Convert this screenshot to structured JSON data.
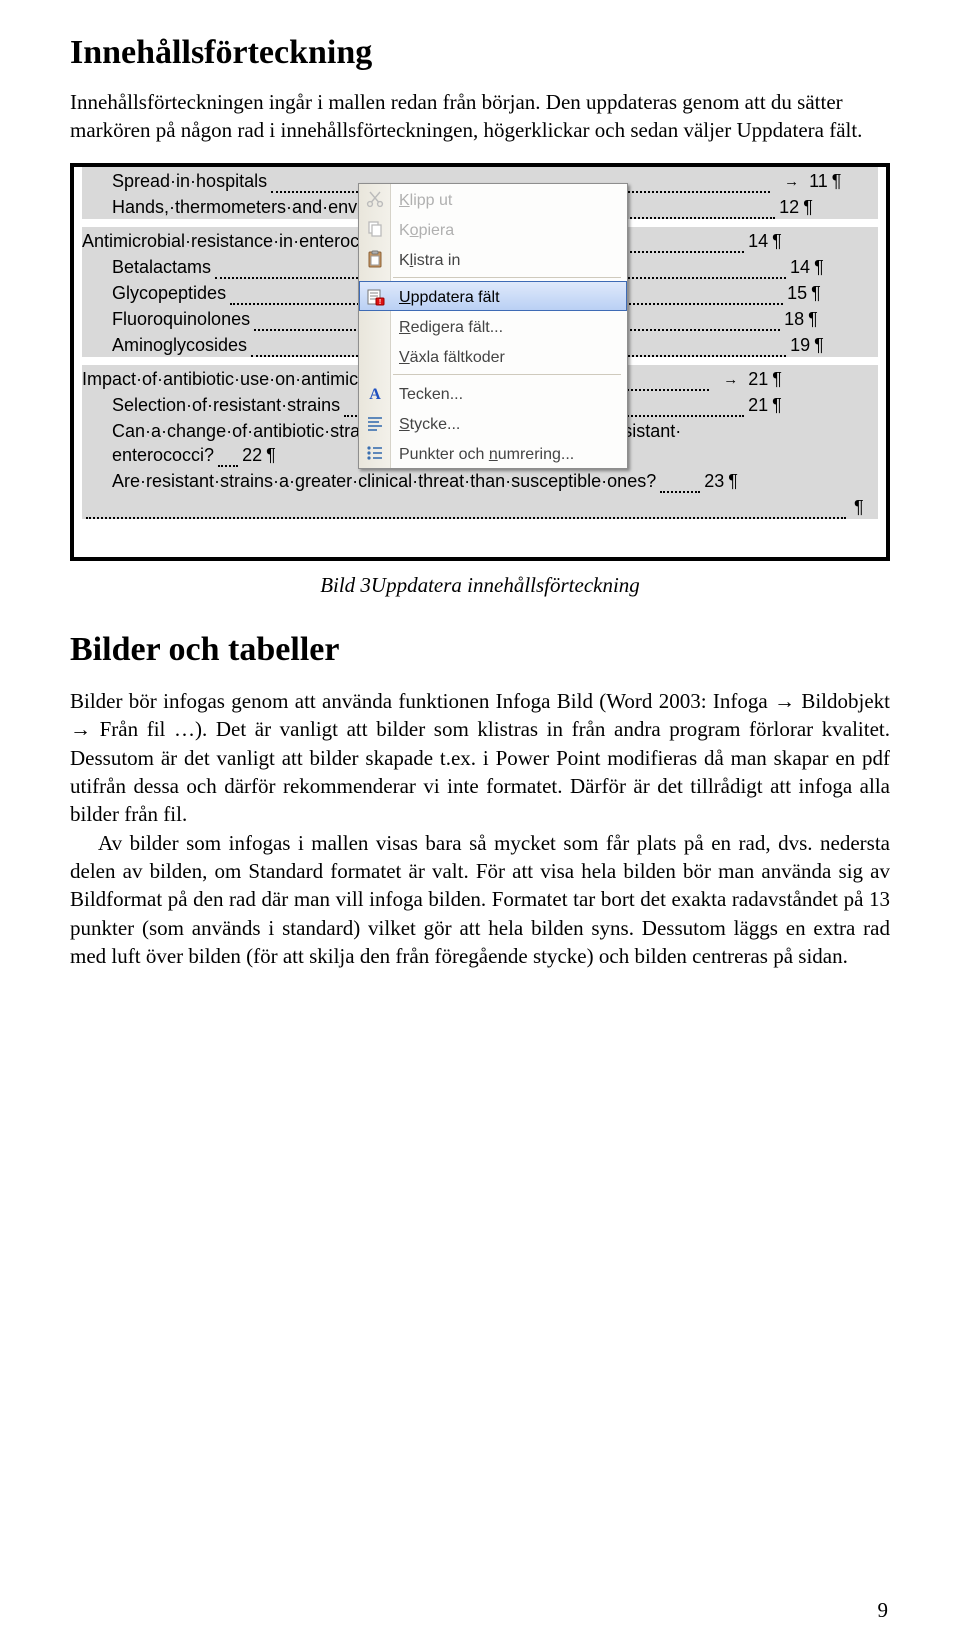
{
  "heading1": "Innehållsförteckning",
  "intro_para": "Innehållsförteckningen ingår i mallen redan från början. Den uppdateras genom att du sätter markören på någon rad i innehållsförteckningen, högerklickar och sedan väljer Uppdatera fält.",
  "caption": "Bild 3Uppdatera innehållsförteckning",
  "heading2": "Bilder och tabeller",
  "body_para": "Bilder bör infogas genom att använda funktionen Infoga Bild (Word 2003: Infoga → Bildobjekt → Från fil …). Det är vanligt att bilder som klistras in från andra program förlorar kvalitet. Dessutom är det vanligt att bilder skapade t.ex. i Power Point modifieras då man skapar en pdf utifrån dessa och därför rekommenderar vi inte formatet. Därför är det tillrådigt att infoga alla bilder från fil.",
  "body_para2_pre": "Av bilder som infogas i mallen visas bara så mycket som får plats på en rad, dvs. nedersta delen av bilden, om Standard formatet är valt. För att visa hela bilden bör man använda sig av Bildformat på den rad där man vill infoga bilden. Formatet tar bort det exakta radavståndet på 13 punk",
  "body_para2_post": "ter (som används i standard) vilket gör att hela bilden syns. Dessutom läggs en extra rad med luft över bilden (för att skilja den från föregående stycke) och bilden centreras på sidan.",
  "page_number": "9",
  "toc_rows": [
    {
      "text": "Spread·in·hospitals",
      "page": "11",
      "level": 2,
      "arrow": true
    },
    {
      "text": "Hands,·thermometers·and·environmental·surfaces",
      "page": "12",
      "level": 2
    },
    {
      "gap": true
    },
    {
      "text": "Antimicrobial·resistance·in·enterococci",
      "page": "14",
      "level": 1
    },
    {
      "text": "Betalactams",
      "page": "14",
      "level": 2
    },
    {
      "text": "Glycopeptides",
      "page": "15",
      "level": 2
    },
    {
      "text": "Fluoroquinolones",
      "page": "18",
      "level": 2
    },
    {
      "text": "Aminoglycosides",
      "page": "19",
      "level": 2
    },
    {
      "gap": true
    },
    {
      "text": "Impact·of·antibiotic·use·on·antimicrobial·resistance·in·enterococci",
      "page": "21",
      "level": 1,
      "arrow": true
    },
    {
      "text": "Selection·of·resistant·strains",
      "page": "21",
      "level": 2
    },
    {
      "text": "Can·a·change·of·antibiotic·strategy·reduce·the·prevalence·of·resistant·",
      "tail": "enterococci?",
      "page": "22",
      "level": 2,
      "wrap": true
    },
    {
      "text": "Are·resistant·strains·a·greater·clinical·threat·than·susceptible·ones?",
      "page": "23",
      "level": 2
    },
    {
      "dots_only": true
    }
  ],
  "context_menu": {
    "klipp": "Klipp ut",
    "kopiera": "Kopiera",
    "klistra": "Klistra in",
    "uppdatera": "Uppdatera fält",
    "redigera": "Redigera fält...",
    "vaxla": "Växla fältkoder",
    "tecken": "Tecken...",
    "stycke": "Stycke...",
    "punkter": "Punkter och numrering..."
  }
}
